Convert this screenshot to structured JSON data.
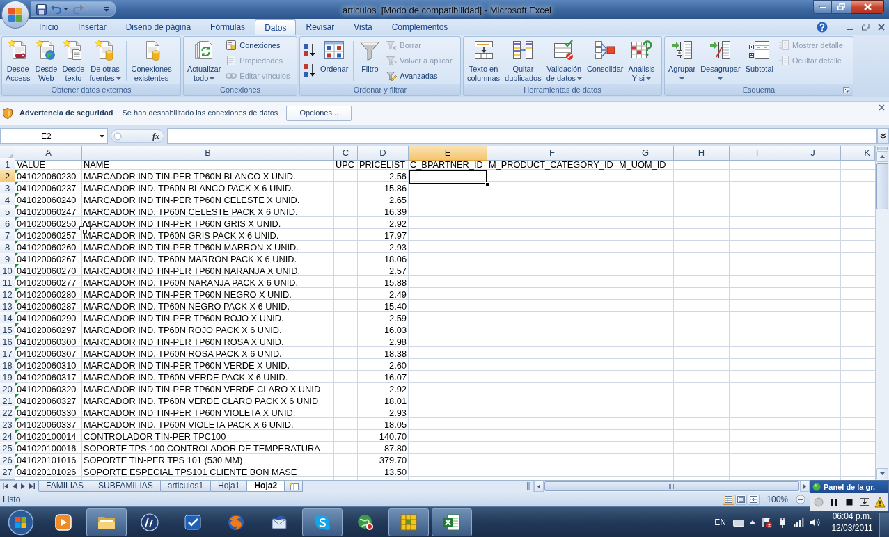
{
  "window": {
    "title": "articulos  [Modo de compatibilidad] - Microsoft Excel"
  },
  "quick_access": [
    {
      "disabled": false
    },
    {
      "disabled": false
    },
    {
      "disabled": true
    }
  ],
  "ribbon_tabs": [
    {
      "label": "Inicio",
      "selected": false
    },
    {
      "label": "Insertar",
      "selected": false
    },
    {
      "label": "Diseño de página",
      "selected": false
    },
    {
      "label": "Fórmulas",
      "selected": false
    },
    {
      "label": "Datos",
      "selected": true
    },
    {
      "label": "Revisar",
      "selected": false
    },
    {
      "label": "Vista",
      "selected": false
    },
    {
      "label": "Complementos",
      "selected": false
    }
  ],
  "ribbon_groups": [
    {
      "label": "Obtener datos externos",
      "items": [
        {
          "kind": "large",
          "lines": [
            "Desde",
            "Access"
          ],
          "dropdown": false,
          "disabled": false
        },
        {
          "kind": "large",
          "lines": [
            "Desde",
            "Web"
          ],
          "dropdown": false,
          "disabled": false
        },
        {
          "kind": "large",
          "lines": [
            "Desde",
            "texto"
          ],
          "dropdown": false,
          "disabled": false
        },
        {
          "kind": "large",
          "lines": [
            "De otras",
            "fuentes"
          ],
          "dropdown": true,
          "disabled": false
        },
        {
          "kind": "separator"
        },
        {
          "kind": "large",
          "lines": [
            "Conexiones",
            "existentes"
          ],
          "dropdown": false,
          "disabled": false
        }
      ]
    },
    {
      "label": "Conexiones",
      "items": [
        {
          "kind": "large",
          "lines": [
            "Actualizar",
            "todo"
          ],
          "dropdown": true,
          "disabled": false
        },
        {
          "kind": "small",
          "label": "Conexiones",
          "disabled": false
        },
        {
          "kind": "small",
          "label": "Propiedades",
          "disabled": true
        },
        {
          "kind": "small",
          "label": "Editar vínculos",
          "disabled": true
        }
      ]
    },
    {
      "label": "Ordenar y filtrar",
      "items": [
        {
          "kind": "sort",
          "disabled": false
        },
        {
          "kind": "sort",
          "disabled": false
        },
        {
          "kind": "large",
          "lines": [
            "Ordenar"
          ],
          "dropdown": false,
          "disabled": false
        },
        {
          "kind": "separator"
        },
        {
          "kind": "large",
          "lines": [
            "Filtro"
          ],
          "dropdown": false,
          "disabled": false
        },
        {
          "kind": "small",
          "label": "Borrar",
          "disabled": true
        },
        {
          "kind": "small",
          "label": "Volver a aplicar",
          "disabled": true
        },
        {
          "kind": "small",
          "label": "Avanzadas",
          "disabled": false
        }
      ]
    },
    {
      "label": "Herramientas de datos",
      "items": [
        {
          "kind": "large",
          "lines": [
            "Texto en",
            "columnas"
          ],
          "dropdown": false,
          "disabled": false
        },
        {
          "kind": "large",
          "lines": [
            "Quitar",
            "duplicados"
          ],
          "dropdown": false,
          "disabled": false
        },
        {
          "kind": "large",
          "lines": [
            "Validación",
            "de datos"
          ],
          "dropdown": true,
          "disabled": false
        },
        {
          "kind": "large",
          "lines": [
            "Consolidar"
          ],
          "dropdown": false,
          "disabled": false
        },
        {
          "kind": "large",
          "lines": [
            "Análisis",
            "Y si"
          ],
          "dropdown": true,
          "disabled": false
        }
      ]
    },
    {
      "label": "Esquema",
      "dialog_launcher": true,
      "items": [
        {
          "kind": "large",
          "lines": [
            "Agrupar"
          ],
          "dropdown": true,
          "disabled": false
        },
        {
          "kind": "large",
          "lines": [
            "Desagrupar"
          ],
          "dropdown": true,
          "disabled": false
        },
        {
          "kind": "large",
          "lines": [
            "Subtotal"
          ],
          "dropdown": false,
          "disabled": false
        },
        {
          "kind": "small",
          "label": "Mostrar detalle",
          "disabled": true
        },
        {
          "kind": "small",
          "label": "Ocultar detalle",
          "disabled": true
        }
      ]
    }
  ],
  "security_bar": {
    "title": "Advertencia de seguridad",
    "message": "Se han deshabilitado las conexiones de datos",
    "button": "Opciones..."
  },
  "formula_bar": {
    "name_box": "E2",
    "function_label": "fx"
  },
  "sheet": {
    "columns": [
      {
        "letter": "A",
        "selected": false
      },
      {
        "letter": "B",
        "selected": false
      },
      {
        "letter": "C",
        "selected": false
      },
      {
        "letter": "D",
        "selected": false
      },
      {
        "letter": "E",
        "selected": true
      },
      {
        "letter": "F",
        "selected": false
      },
      {
        "letter": "G",
        "selected": false
      },
      {
        "letter": "H",
        "selected": false
      },
      {
        "letter": "I",
        "selected": false
      },
      {
        "letter": "J",
        "selected": false
      },
      {
        "letter": "K",
        "selected": false
      }
    ],
    "header_row": {
      "number": "1",
      "selected": false,
      "cells": [
        "VALUE",
        "NAME",
        "UPC",
        "PRICELIST",
        "C_BPARTNER_ID",
        "M_PRODUCT_CATEGORY_ID",
        "M_UOM_ID"
      ]
    },
    "rows": [
      {
        "number": "2",
        "selected": true,
        "value": "041020060230",
        "name": "MARCADOR IND TIN-PER TP60N BLANCO X UNID.",
        "pricelist": "2.56",
        "text_flag": true
      },
      {
        "number": "3",
        "selected": false,
        "value": "041020060237",
        "name": "MARCADOR IND. TP60N BLANCO PACK X 6 UNID.",
        "pricelist": "15.86",
        "text_flag": true
      },
      {
        "number": "4",
        "selected": false,
        "value": "041020060240",
        "name": "MARCADOR IND TIN-PER TP60N CELESTE X UNID.",
        "pricelist": "2.65",
        "text_flag": true
      },
      {
        "number": "5",
        "selected": false,
        "value": "041020060247",
        "name": "MARCADOR IND. TP60N CELESTE PACK X 6 UNID.",
        "pricelist": "16.39",
        "text_flag": true
      },
      {
        "number": "6",
        "selected": false,
        "value": "041020060250",
        "name": "MARCADOR IND TIN-PER TP60N GRIS X UNID.",
        "pricelist": "2.92",
        "text_flag": true
      },
      {
        "number": "7",
        "selected": false,
        "value": "041020060257",
        "name": "MARCADOR IND. TP60N GRIS PACK X 6 UNID.",
        "pricelist": "17.97",
        "text_flag": true
      },
      {
        "number": "8",
        "selected": false,
        "value": "041020060260",
        "name": "MARCADOR IND TIN-PER TP60N MARRON X UNID.",
        "pricelist": "2.93",
        "text_flag": true
      },
      {
        "number": "9",
        "selected": false,
        "value": "041020060267",
        "name": "MARCADOR IND. TP60N MARRON PACK X 6 UNID.",
        "pricelist": "18.06",
        "text_flag": true
      },
      {
        "number": "10",
        "selected": false,
        "value": "041020060270",
        "name": "MARCADOR IND TIN-PER TP60N NARANJA X UNID.",
        "pricelist": "2.57",
        "text_flag": true
      },
      {
        "number": "11",
        "selected": false,
        "value": "041020060277",
        "name": "MARCADOR IND. TP60N NARANJA PACK X 6 UNID.",
        "pricelist": "15.88",
        "text_flag": true
      },
      {
        "number": "12",
        "selected": false,
        "value": "041020060280",
        "name": "MARCADOR IND TIN-PER TP60N NEGRO X UNID.",
        "pricelist": "2.49",
        "text_flag": true
      },
      {
        "number": "13",
        "selected": false,
        "value": "041020060287",
        "name": "MARCADOR IND. TP60N NEGRO PACK X 6 UNID.",
        "pricelist": "15.40",
        "text_flag": true
      },
      {
        "number": "14",
        "selected": false,
        "value": "041020060290",
        "name": "MARCADOR IND TIN-PER TP60N ROJO X UNID.",
        "pricelist": "2.59",
        "text_flag": true
      },
      {
        "number": "15",
        "selected": false,
        "value": "041020060297",
        "name": "MARCADOR IND. TP60N ROJO PACK X 6 UNID.",
        "pricelist": "16.03",
        "text_flag": true
      },
      {
        "number": "16",
        "selected": false,
        "value": "041020060300",
        "name": "MARCADOR IND TIN-PER TP60N ROSA X UNID.",
        "pricelist": "2.98",
        "text_flag": true
      },
      {
        "number": "17",
        "selected": false,
        "value": "041020060307",
        "name": "MARCADOR IND. TP60N ROSA PACK X 6 UNID.",
        "pricelist": "18.38",
        "text_flag": true
      },
      {
        "number": "18",
        "selected": false,
        "value": "041020060310",
        "name": "MARCADOR IND TIN-PER TP60N VERDE X UNID.",
        "pricelist": "2.60",
        "text_flag": true
      },
      {
        "number": "19",
        "selected": false,
        "value": "041020060317",
        "name": "MARCADOR IND. TP60N VERDE PACK X 6 UNID.",
        "pricelist": "16.07",
        "text_flag": true
      },
      {
        "number": "20",
        "selected": false,
        "value": "041020060320",
        "name": "MARCADOR IND TIN-PER TP60N VERDE CLARO X UNID",
        "pricelist": "2.92",
        "text_flag": true
      },
      {
        "number": "21",
        "selected": false,
        "value": "041020060327",
        "name": "MARCADOR IND. TP60N VERDE CLARO PACK X 6 UNID",
        "pricelist": "18.01",
        "text_flag": true
      },
      {
        "number": "22",
        "selected": false,
        "value": "041020060330",
        "name": "MARCADOR IND TIN-PER TP60N VIOLETA X UNID.",
        "pricelist": "2.93",
        "text_flag": true
      },
      {
        "number": "23",
        "selected": false,
        "value": "041020060337",
        "name": "MARCADOR IND. TP60N VIOLETA PACK X 6 UNID.",
        "pricelist": "18.05",
        "text_flag": true
      },
      {
        "number": "24",
        "selected": false,
        "value": "041020100014",
        "name": "CONTROLADOR TIN-PER TPC100",
        "pricelist": "140.70",
        "text_flag": true
      },
      {
        "number": "25",
        "selected": false,
        "value": "041020100016",
        "name": "SOPORTE TPS-100 CONTROLADOR DE TEMPERATURA",
        "pricelist": "87.80",
        "text_flag": true
      },
      {
        "number": "26",
        "selected": false,
        "value": "041020101016",
        "name": "SOPORTE TIN-PER TPS 101 (530 MM)",
        "pricelist": "379.70",
        "text_flag": true
      },
      {
        "number": "27",
        "selected": false,
        "value": "041020101026",
        "name": "SOPORTE ESPECIAL TPS101 CLIENTE BON MASE",
        "pricelist": "13.50",
        "text_flag": true
      }
    ]
  },
  "sheet_tabs": [
    {
      "label": "FAMILIAS",
      "selected": false
    },
    {
      "label": "SUBFAMILIAS",
      "selected": false
    },
    {
      "label": "articulos1",
      "selected": false
    },
    {
      "label": "Hoja1",
      "selected": false
    },
    {
      "label": "Hoja2",
      "selected": true
    }
  ],
  "status_bar": {
    "text": "Listo",
    "views": [
      {
        "selected": true
      },
      {
        "selected": false
      },
      {
        "selected": false
      }
    ],
    "zoom": "100%"
  },
  "recorder_panel": {
    "title": "Panel de la gr."
  },
  "taskbar": {
    "apps": [
      {
        "running": false
      },
      {
        "running": true
      },
      {
        "running": false
      },
      {
        "running": false
      },
      {
        "running": false
      },
      {
        "running": false
      },
      {
        "running": true
      },
      {
        "running": false
      },
      {
        "running": true
      },
      {
        "running": true
      }
    ],
    "language": "EN",
    "time": "06:04 p.m.",
    "date": "12/03/2011"
  }
}
